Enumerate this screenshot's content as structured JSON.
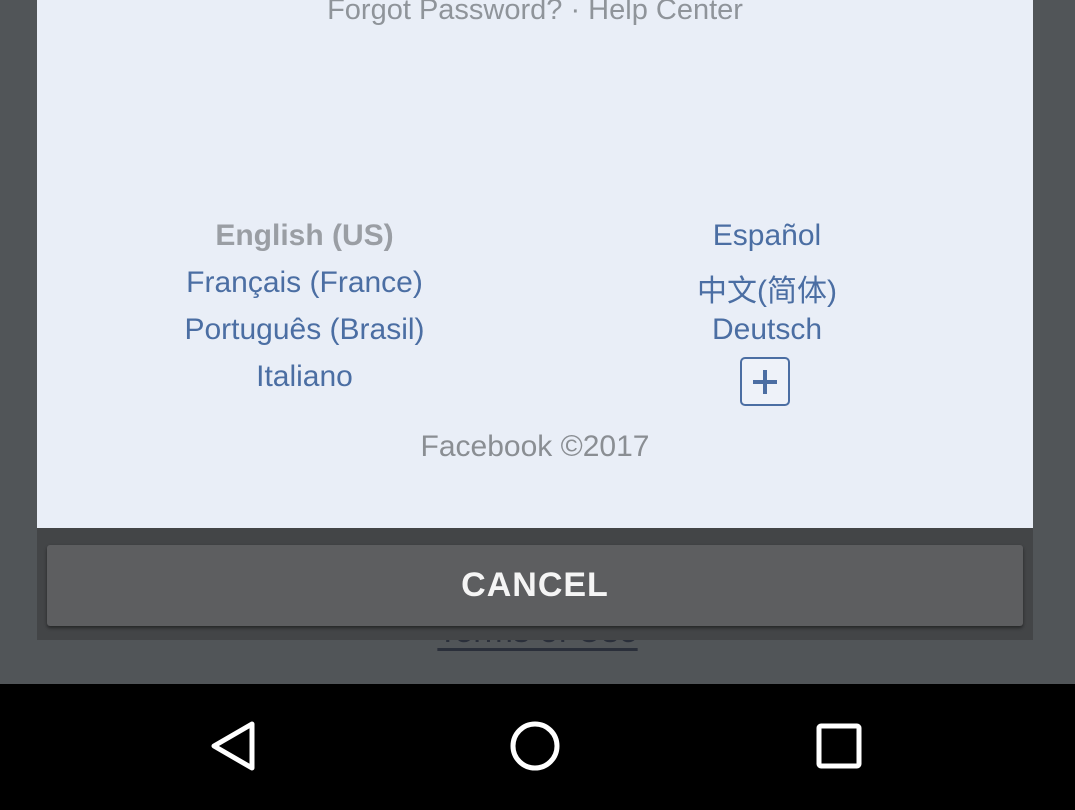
{
  "background": {
    "link_text": "Terms of Use"
  },
  "sheet": {
    "top_links": "Forgot Password? · Help Center",
    "languages_left": [
      "English (US)",
      "Français (France)",
      "Português (Brasil)",
      "Italiano"
    ],
    "languages_right": [
      "Español",
      "中文(简体)",
      "Deutsch"
    ],
    "current_language": "English (US)",
    "more_languages_icon": "plus-box-icon",
    "copyright": "Facebook ©2017"
  },
  "dialog": {
    "cancel_label": "CANCEL"
  },
  "navigation_bar": {
    "buttons": [
      "back-icon",
      "home-icon",
      "recents-icon"
    ]
  },
  "colors": {
    "link_blue": "#4b6ea3",
    "sheet_background": "#e9eef7",
    "cancel_button": "#5d5e60"
  }
}
